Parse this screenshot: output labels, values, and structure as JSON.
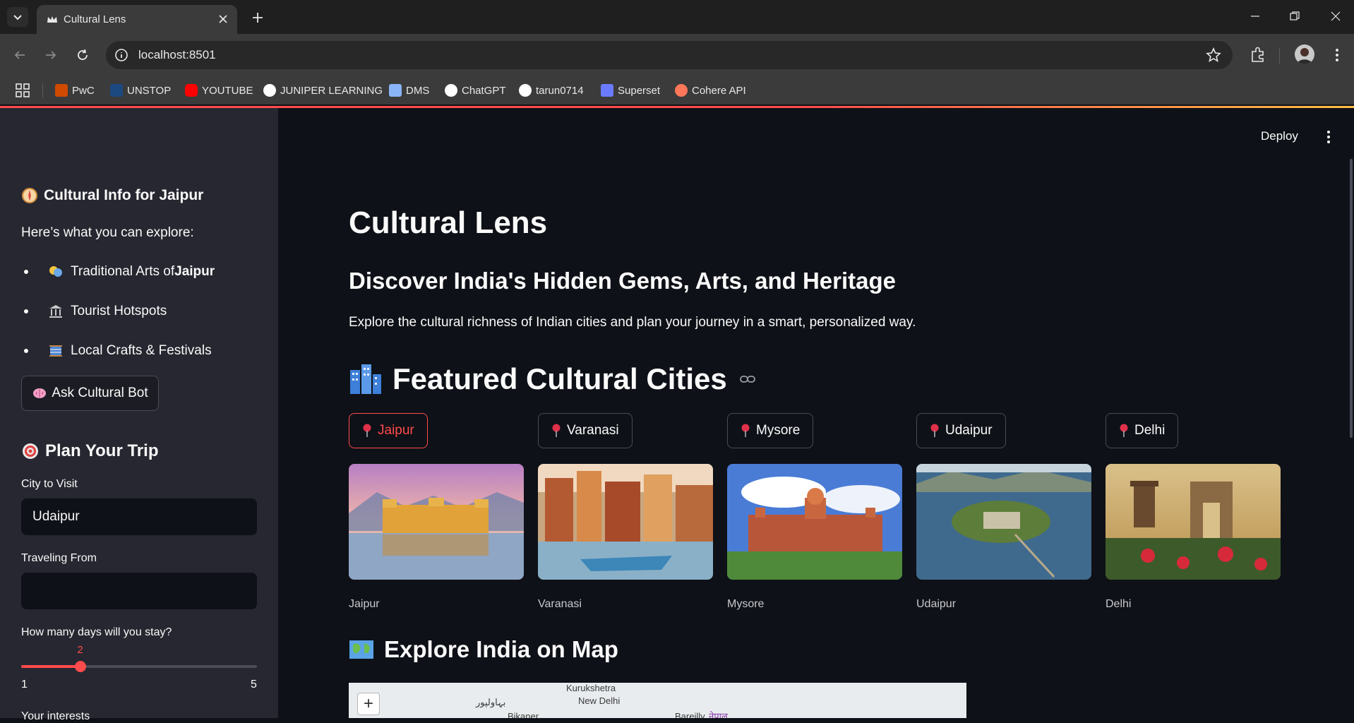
{
  "browser": {
    "tab_title": "Cultural Lens",
    "url": "localhost:8501",
    "bookmarks": [
      {
        "label": "PwC",
        "icon": "pwc-icon",
        "color": "#d04a02"
      },
      {
        "label": "UNSTOP",
        "icon": "unstop-icon",
        "color": "#1c4980"
      },
      {
        "label": "YOUTUBE",
        "icon": "youtube-icon",
        "color": "#ff0000"
      },
      {
        "label": "JUNIPER LEARNING",
        "icon": "juniper-icon",
        "color": "#ffffff"
      },
      {
        "label": "DMS",
        "icon": "document-icon",
        "color": "#8ab4f8"
      },
      {
        "label": "ChatGPT",
        "icon": "chatgpt-icon",
        "color": "#ffffff"
      },
      {
        "label": "tarun0714",
        "icon": "github-icon",
        "color": "#ffffff"
      },
      {
        "label": "Superset",
        "icon": "superset-icon",
        "color": "#6b7bff"
      },
      {
        "label": "Cohere API",
        "icon": "cohere-icon",
        "color": "#ff7759"
      }
    ]
  },
  "sidebar": {
    "info_heading": "Cultural Info for Jaipur",
    "explore_intro": "Here’s what you can explore:",
    "explore_items": [
      {
        "prefix": "Traditional Arts of ",
        "bold": "Jaipur",
        "icon": "theater-masks-icon"
      },
      {
        "prefix": "Tourist Hotspots",
        "bold": "",
        "icon": "classical-building-icon"
      },
      {
        "prefix": "Local Crafts & Festivals",
        "bold": "",
        "icon": "thread-icon"
      }
    ],
    "ask_button": "Ask Cultural Bot",
    "plan_heading": "Plan Your Trip",
    "city_label": "City to Visit",
    "city_value": "Udaipur",
    "from_label": "Traveling From",
    "from_value": "",
    "days_label": "How many days will you stay?",
    "days_value": 2,
    "days_min": 1,
    "days_max": 5,
    "next_label_partial": "Your interests"
  },
  "main": {
    "deploy_label": "Deploy",
    "title": "Cultural Lens",
    "subtitle": "Discover India's Hidden Gems, Arts, and Heritage",
    "description": "Explore the cultural richness of Indian cities and plan your journey in a smart, personalized way.",
    "featured_heading": "Featured Cultural Cities",
    "selected_city": "Jaipur",
    "cities": [
      {
        "name": "Jaipur",
        "caption": "Jaipur"
      },
      {
        "name": "Varanasi",
        "caption": "Varanasi"
      },
      {
        "name": "Mysore",
        "caption": "Mysore"
      },
      {
        "name": "Udaipur",
        "caption": "Udaipur"
      },
      {
        "name": "Delhi",
        "caption": "Delhi"
      }
    ],
    "map_heading": "Explore India on Map",
    "map_labels": [
      "Kurukshetra",
      "New Delhi",
      "بہاولپور",
      "Bikaner",
      "Bareilly",
      "नेपाल"
    ],
    "accent_color": "#ff4b4b"
  }
}
